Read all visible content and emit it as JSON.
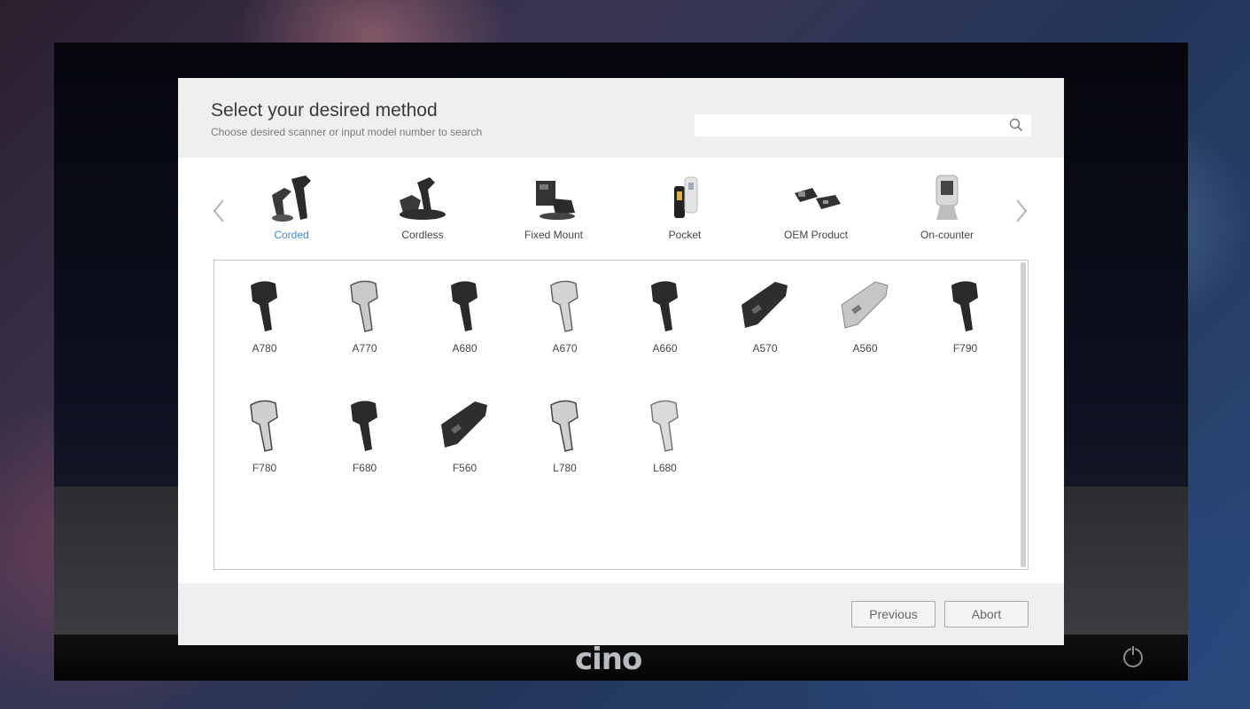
{
  "dialog": {
    "title": "Select your desired method",
    "subtitle": "Choose desired scanner or input model number to search",
    "search": {
      "value": "",
      "placeholder": ""
    }
  },
  "categories": {
    "selected": "Corded",
    "items": [
      {
        "label": "Corded",
        "icon": "corded-scanner-icon"
      },
      {
        "label": "Cordless",
        "icon": "cordless-scanner-icon"
      },
      {
        "label": "Fixed Mount",
        "icon": "fixed-mount-scanner-icon"
      },
      {
        "label": "Pocket",
        "icon": "pocket-scanner-icon"
      },
      {
        "label": "OEM Product",
        "icon": "oem-module-icon"
      },
      {
        "label": "On-counter",
        "icon": "on-counter-scanner-icon"
      }
    ]
  },
  "models": [
    {
      "label": "A780",
      "tone": "dark"
    },
    {
      "label": "A770",
      "tone": "light"
    },
    {
      "label": "A680",
      "tone": "dark"
    },
    {
      "label": "A670",
      "tone": "light"
    },
    {
      "label": "A660",
      "tone": "dark"
    },
    {
      "label": "A570",
      "tone": "dark-wide"
    },
    {
      "label": "A560",
      "tone": "light-wide"
    },
    {
      "label": "F790",
      "tone": "dark"
    },
    {
      "label": "F780",
      "tone": "light"
    },
    {
      "label": "F680",
      "tone": "dark"
    },
    {
      "label": "F560",
      "tone": "dark-wide"
    },
    {
      "label": "L780",
      "tone": "light"
    },
    {
      "label": "L680",
      "tone": "light"
    }
  ],
  "footer": {
    "previous_label": "Previous",
    "abort_label": "Abort"
  },
  "brand": {
    "logo_text": "cino"
  },
  "colors": {
    "accent": "#3b8ad8",
    "header_bg": "#efefef",
    "text": "#3a3a3a"
  }
}
